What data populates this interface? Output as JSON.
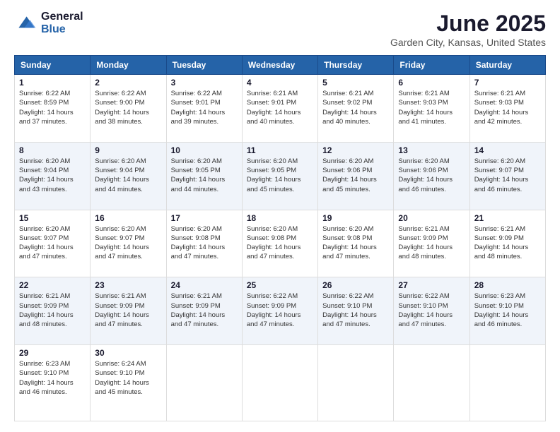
{
  "logo": {
    "general": "General",
    "blue": "Blue"
  },
  "title": "June 2025",
  "subtitle": "Garden City, Kansas, United States",
  "days_header": [
    "Sunday",
    "Monday",
    "Tuesday",
    "Wednesday",
    "Thursday",
    "Friday",
    "Saturday"
  ],
  "weeks": [
    [
      {
        "day": "1",
        "sunrise": "6:22 AM",
        "sunset": "8:59 PM",
        "daylight": "14 hours and 37 minutes."
      },
      {
        "day": "2",
        "sunrise": "6:22 AM",
        "sunset": "9:00 PM",
        "daylight": "14 hours and 38 minutes."
      },
      {
        "day": "3",
        "sunrise": "6:22 AM",
        "sunset": "9:01 PM",
        "daylight": "14 hours and 39 minutes."
      },
      {
        "day": "4",
        "sunrise": "6:21 AM",
        "sunset": "9:01 PM",
        "daylight": "14 hours and 40 minutes."
      },
      {
        "day": "5",
        "sunrise": "6:21 AM",
        "sunset": "9:02 PM",
        "daylight": "14 hours and 40 minutes."
      },
      {
        "day": "6",
        "sunrise": "6:21 AM",
        "sunset": "9:03 PM",
        "daylight": "14 hours and 41 minutes."
      },
      {
        "day": "7",
        "sunrise": "6:21 AM",
        "sunset": "9:03 PM",
        "daylight": "14 hours and 42 minutes."
      }
    ],
    [
      {
        "day": "8",
        "sunrise": "6:20 AM",
        "sunset": "9:04 PM",
        "daylight": "14 hours and 43 minutes."
      },
      {
        "day": "9",
        "sunrise": "6:20 AM",
        "sunset": "9:04 PM",
        "daylight": "14 hours and 44 minutes."
      },
      {
        "day": "10",
        "sunrise": "6:20 AM",
        "sunset": "9:05 PM",
        "daylight": "14 hours and 44 minutes."
      },
      {
        "day": "11",
        "sunrise": "6:20 AM",
        "sunset": "9:05 PM",
        "daylight": "14 hours and 45 minutes."
      },
      {
        "day": "12",
        "sunrise": "6:20 AM",
        "sunset": "9:06 PM",
        "daylight": "14 hours and 45 minutes."
      },
      {
        "day": "13",
        "sunrise": "6:20 AM",
        "sunset": "9:06 PM",
        "daylight": "14 hours and 46 minutes."
      },
      {
        "day": "14",
        "sunrise": "6:20 AM",
        "sunset": "9:07 PM",
        "daylight": "14 hours and 46 minutes."
      }
    ],
    [
      {
        "day": "15",
        "sunrise": "6:20 AM",
        "sunset": "9:07 PM",
        "daylight": "14 hours and 47 minutes."
      },
      {
        "day": "16",
        "sunrise": "6:20 AM",
        "sunset": "9:07 PM",
        "daylight": "14 hours and 47 minutes."
      },
      {
        "day": "17",
        "sunrise": "6:20 AM",
        "sunset": "9:08 PM",
        "daylight": "14 hours and 47 minutes."
      },
      {
        "day": "18",
        "sunrise": "6:20 AM",
        "sunset": "9:08 PM",
        "daylight": "14 hours and 47 minutes."
      },
      {
        "day": "19",
        "sunrise": "6:20 AM",
        "sunset": "9:08 PM",
        "daylight": "14 hours and 47 minutes."
      },
      {
        "day": "20",
        "sunrise": "6:21 AM",
        "sunset": "9:09 PM",
        "daylight": "14 hours and 48 minutes."
      },
      {
        "day": "21",
        "sunrise": "6:21 AM",
        "sunset": "9:09 PM",
        "daylight": "14 hours and 48 minutes."
      }
    ],
    [
      {
        "day": "22",
        "sunrise": "6:21 AM",
        "sunset": "9:09 PM",
        "daylight": "14 hours and 48 minutes."
      },
      {
        "day": "23",
        "sunrise": "6:21 AM",
        "sunset": "9:09 PM",
        "daylight": "14 hours and 47 minutes."
      },
      {
        "day": "24",
        "sunrise": "6:21 AM",
        "sunset": "9:09 PM",
        "daylight": "14 hours and 47 minutes."
      },
      {
        "day": "25",
        "sunrise": "6:22 AM",
        "sunset": "9:09 PM",
        "daylight": "14 hours and 47 minutes."
      },
      {
        "day": "26",
        "sunrise": "6:22 AM",
        "sunset": "9:10 PM",
        "daylight": "14 hours and 47 minutes."
      },
      {
        "day": "27",
        "sunrise": "6:22 AM",
        "sunset": "9:10 PM",
        "daylight": "14 hours and 47 minutes."
      },
      {
        "day": "28",
        "sunrise": "6:23 AM",
        "sunset": "9:10 PM",
        "daylight": "14 hours and 46 minutes."
      }
    ],
    [
      {
        "day": "29",
        "sunrise": "6:23 AM",
        "sunset": "9:10 PM",
        "daylight": "14 hours and 46 minutes."
      },
      {
        "day": "30",
        "sunrise": "6:24 AM",
        "sunset": "9:10 PM",
        "daylight": "14 hours and 45 minutes."
      },
      null,
      null,
      null,
      null,
      null
    ]
  ]
}
